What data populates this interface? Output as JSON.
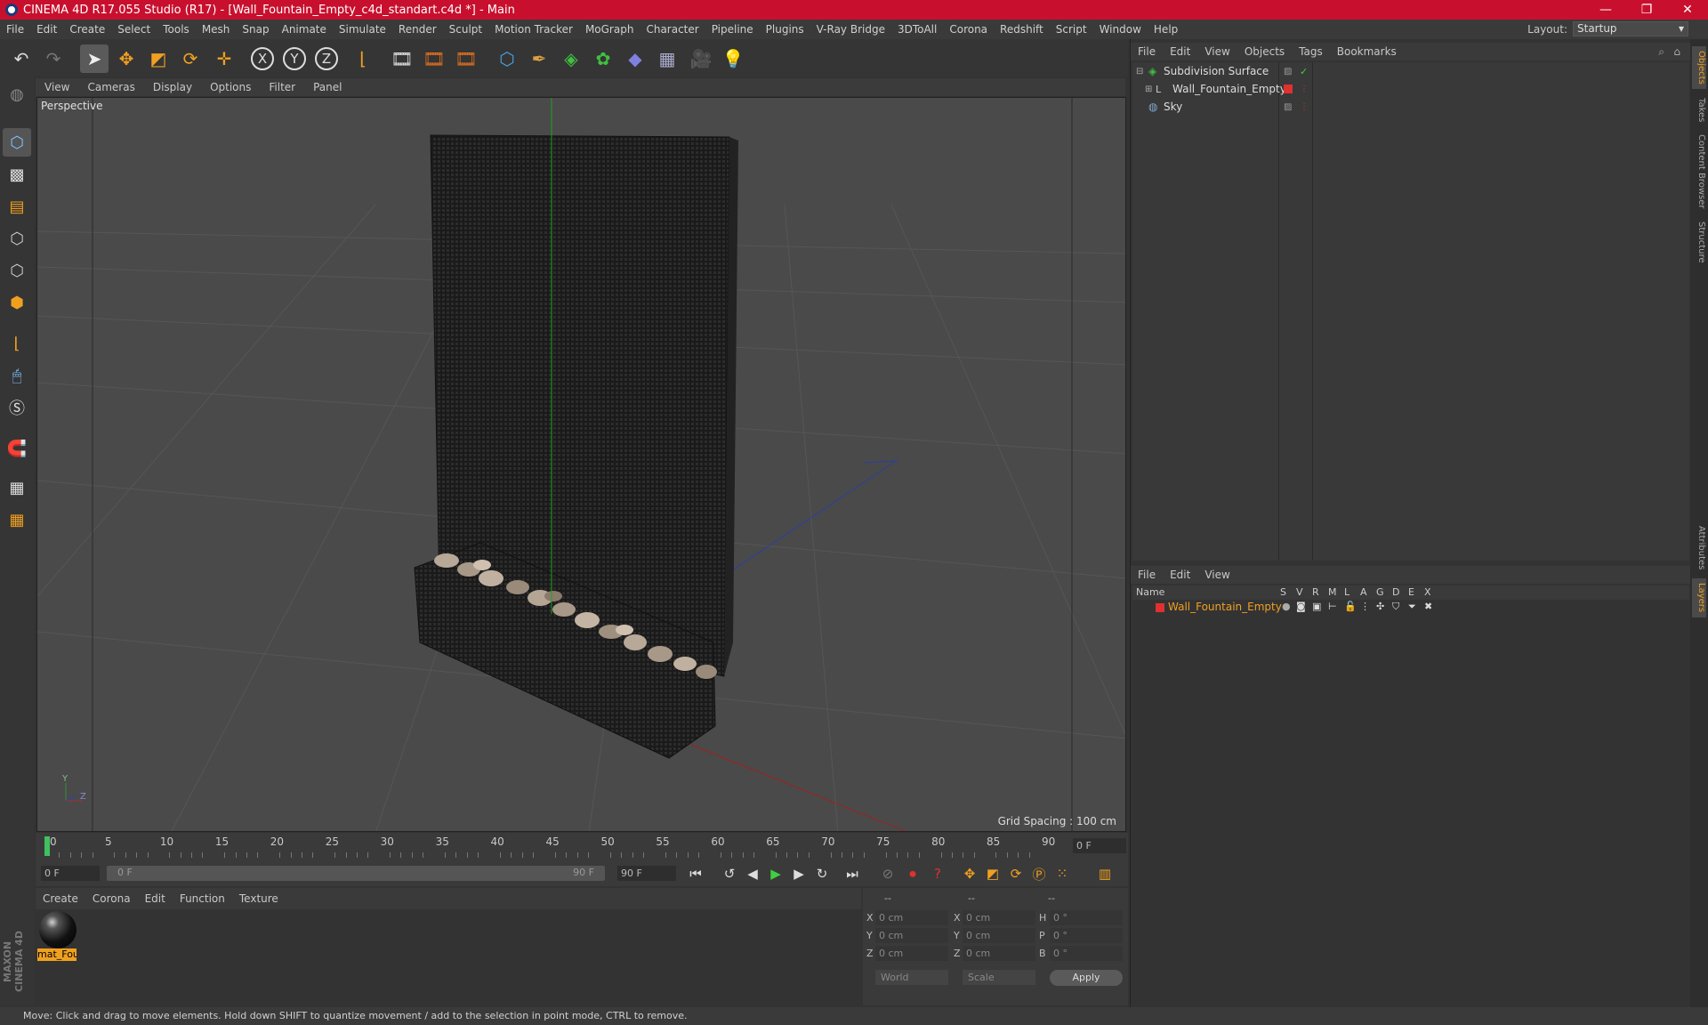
{
  "window": {
    "title": "CINEMA 4D R17.055 Studio (R17) - [Wall_Fountain_Empty_c4d_standart.c4d *] - Main",
    "controls": [
      "—",
      "❐",
      "✕"
    ]
  },
  "menubar": {
    "items": [
      "File",
      "Edit",
      "Create",
      "Select",
      "Tools",
      "Mesh",
      "Snap",
      "Animate",
      "Simulate",
      "Render",
      "Sculpt",
      "Motion Tracker",
      "MoGraph",
      "Character",
      "Pipeline",
      "Plugins",
      "V-Ray Bridge",
      "3DToAll",
      "Corona",
      "Redshift",
      "Script",
      "Window",
      "Help"
    ],
    "layout_label": "Layout:",
    "layout_value": "Startup"
  },
  "toolbar": {
    "icons": [
      "undo-icon",
      "redo-icon",
      "select-icon",
      "move-icon",
      "scale-icon",
      "rotate-icon",
      "transform-icon",
      "x-axis-icon",
      "y-axis-icon",
      "z-axis-icon",
      "coordinate-icon",
      "render-view-icon",
      "render-picture-icon",
      "render-settings-icon",
      "cube-icon",
      "pen-icon",
      "subdivision-icon",
      "cloner-icon",
      "deformer-icon",
      "floor-icon",
      "camera-icon",
      "light-icon"
    ],
    "axis_labels": [
      "X",
      "Y",
      "Z"
    ]
  },
  "viewport": {
    "menu": [
      "View",
      "Cameras",
      "Display",
      "Options",
      "Filter",
      "Panel"
    ],
    "label": "Perspective",
    "grid_spacing": "Grid Spacing : 100 cm",
    "axis_labels": [
      "Y",
      "Z"
    ]
  },
  "timeline": {
    "ticks": [
      "0",
      "5",
      "10",
      "15",
      "20",
      "25",
      "30",
      "35",
      "40",
      "45",
      "50",
      "55",
      "60",
      "65",
      "70",
      "75",
      "80",
      "85",
      "90"
    ],
    "current_frame": "0 F"
  },
  "transport": {
    "start": "0 F",
    "range_start": "0 F",
    "range_end": "90 F",
    "end": "90 F"
  },
  "materials": {
    "menu": [
      "Create",
      "Corona",
      "Edit",
      "Function",
      "Texture"
    ],
    "items": [
      {
        "name": "mat_Fou"
      }
    ]
  },
  "coords": {
    "headers": [
      "--",
      "--",
      "--"
    ],
    "rows": [
      {
        "a": "X",
        "av": "0 cm",
        "b": "X",
        "bv": "0 cm",
        "c": "H",
        "cv": "0 °"
      },
      {
        "a": "Y",
        "av": "0 cm",
        "b": "Y",
        "bv": "0 cm",
        "c": "P",
        "cv": "0 °"
      },
      {
        "a": "Z",
        "av": "0 cm",
        "b": "Z",
        "bv": "0 cm",
        "c": "B",
        "cv": "0 °"
      }
    ],
    "world": "World",
    "scale": "Scale",
    "apply": "Apply"
  },
  "objects": {
    "menu": [
      "File",
      "Edit",
      "View",
      "Objects",
      "Tags",
      "Bookmarks"
    ],
    "items": [
      {
        "name": "Subdivision Surface"
      },
      {
        "name": "Wall_Fountain_Empty"
      },
      {
        "name": "Sky"
      }
    ]
  },
  "layers": {
    "menu": [
      "File",
      "Edit",
      "View"
    ],
    "header": {
      "name": "Name",
      "cols": [
        "S",
        "V",
        "R",
        "M",
        "L",
        "A",
        "G",
        "D",
        "E",
        "X"
      ]
    },
    "items": [
      {
        "name": "Wall_Fountain_Empty",
        "color": "#e03030"
      }
    ]
  },
  "side_tabs": [
    "Objects",
    "Takes",
    "Content Browser",
    "Structure",
    "Attributes",
    "Layers"
  ],
  "status": "Move: Click and drag to move elements. Hold down SHIFT to quantize movement / add to the selection in point mode, CTRL to remove.",
  "colors": {
    "title_red": "#c8102e",
    "accent": "#f0a020"
  }
}
